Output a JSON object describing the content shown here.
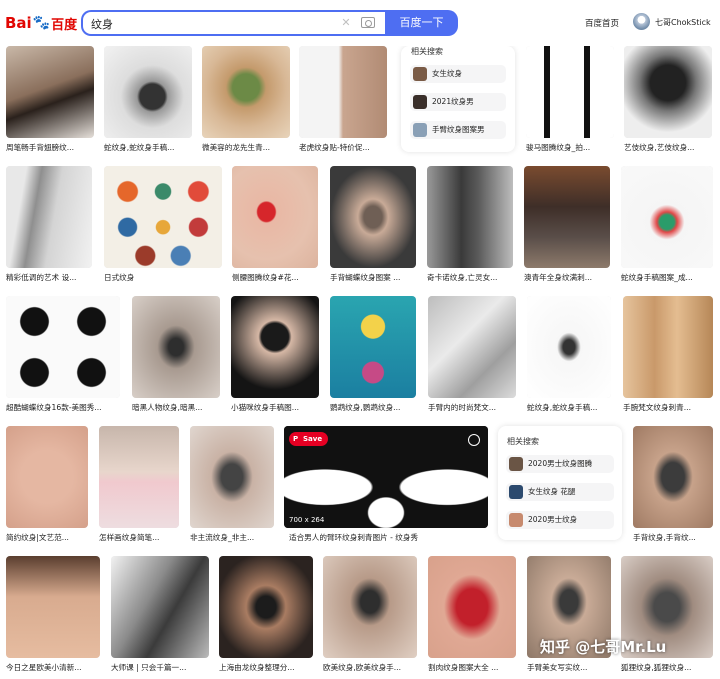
{
  "header": {
    "logo_text_1": "Bai",
    "logo_paw": "🐾",
    "logo_text_2": "百度",
    "search_value": "纹身",
    "search_button": "百度一下",
    "home_link": "百度首页",
    "user_name": "七哥ChokStick"
  },
  "images": [
    {
      "caption": "周笔畅手背翅膀纹..."
    },
    {
      "caption": "蛇纹身,蛇纹身手稿..."
    },
    {
      "caption": "微美容的龙先生青..."
    },
    {
      "caption": "老虎纹身贴-特价促..."
    },
    {
      "caption": "骏马图腾纹身_拍..."
    },
    {
      "caption": "艺伎纹身,艺伎纹身..."
    },
    {
      "caption": "精彩低调的艺术 设..."
    },
    {
      "caption": "日式纹身"
    },
    {
      "caption": "侧腰图腾纹身#花..."
    },
    {
      "caption": "手背蝴蝶纹身图案 ..."
    },
    {
      "caption": "奇卡诺纹身,亡灵女..."
    },
    {
      "caption": "澳青年全身纹满刺..."
    },
    {
      "caption": "蛇纹身手稿图案_成..."
    },
    {
      "caption": "超酷蝴蝶纹身16款-美图秀..."
    },
    {
      "caption": "暗黑人物纹身,暗黑..."
    },
    {
      "caption": "小猫咪纹身手稿图..."
    },
    {
      "caption": "鹦鹉纹身,鹦鹉纹身..."
    },
    {
      "caption": "手臂内的时尚梵文..."
    },
    {
      "caption": "蛇纹身,蛇纹身手稿..."
    },
    {
      "caption": "手腕梵文纹身刺青..."
    },
    {
      "caption": "简约纹身|文艺范..."
    },
    {
      "caption": "怎样画纹身简笔..."
    },
    {
      "caption": "非主流纹身_非主..."
    },
    {
      "caption": "适合男人的臂环纹身刺青图片 - 纹身秀"
    },
    {
      "caption": "手背纹身,手背纹..."
    },
    {
      "caption": "今日之星欧美小清新..."
    },
    {
      "caption": "大师课 | 只会千篇一..."
    },
    {
      "caption": "上海由龙纹身整理分..."
    },
    {
      "caption": "欧美纹身,欧美纹身手..."
    },
    {
      "caption": "割肉纹身图案大全 ..."
    },
    {
      "caption": "手臂美女写实纹..."
    },
    {
      "caption": "狐狸纹身,狐狸纹身..."
    }
  ],
  "related_top": {
    "title": "相关搜索",
    "items": [
      "女生纹身",
      "2021纹身男",
      "手臂纹身图案男"
    ]
  },
  "related_mid": {
    "title": "相关搜索",
    "items": [
      "2020男士纹身图腾",
      "女生纹身 花腿",
      "2020男士纹身"
    ]
  },
  "overlay": {
    "save": "Save",
    "dims": "700 x 264"
  },
  "watermark": "知乎 @七哥Mr.Lu"
}
